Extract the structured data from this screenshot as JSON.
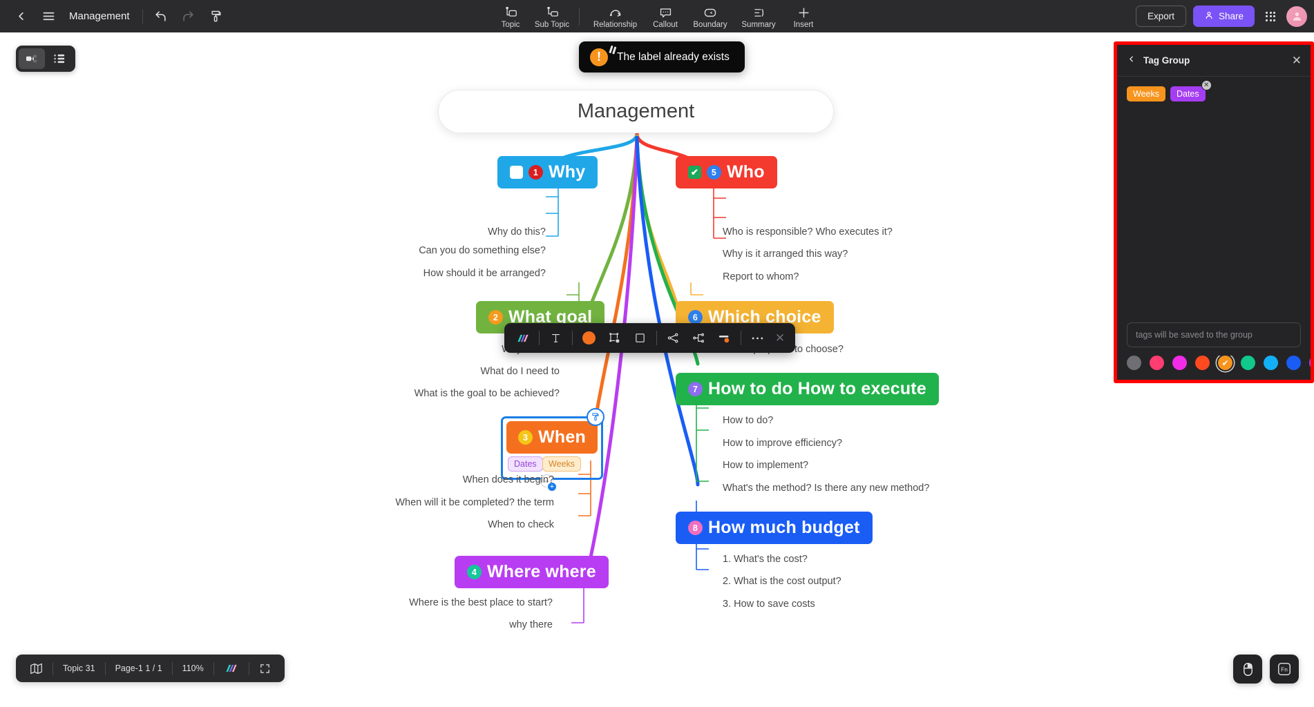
{
  "app": {
    "title": "Management",
    "topbar": {
      "back_icon": "back-chevron-icon",
      "menu_icon": "hamburger-menu-icon",
      "undo_icon": "undo-icon",
      "redo_icon": "redo-icon",
      "format_painter_icon": "format-painter-icon",
      "tools": [
        {
          "label": "Topic",
          "icon": "topic-icon"
        },
        {
          "label": "Sub Topic",
          "icon": "sub-topic-icon"
        },
        {
          "label": "Relationship",
          "icon": "relationship-icon"
        },
        {
          "label": "Callout",
          "icon": "callout-icon"
        },
        {
          "label": "Boundary",
          "icon": "boundary-icon"
        },
        {
          "label": "Summary",
          "icon": "summary-icon"
        },
        {
          "label": "Insert",
          "icon": "insert-plus-icon"
        }
      ],
      "export_label": "Export",
      "share_label": "Share",
      "apps_icon": "apps-grid-icon",
      "avatar_icon": "user-avatar"
    }
  },
  "toast": {
    "message": "The label already exists",
    "icon": "warning-exclamation-icon"
  },
  "view_toggle": {
    "mindmap_icon": "mindmap-view-icon",
    "outline_icon": "outline-view-icon"
  },
  "mindmap": {
    "root": {
      "label": "Management"
    },
    "branches": [
      {
        "id": "why",
        "label": "Why",
        "number": "1",
        "color": "#1fa7e8",
        "badge_color": "#d91f1f",
        "checkbox": "unchecked",
        "children": [
          "Why do this?",
          "Can you do something else?",
          "How should it be arranged?"
        ]
      },
      {
        "id": "what-goal",
        "label": "What goal",
        "number": "2",
        "color": "#72b340",
        "badge_color": "#f59b1e",
        "children": [
          "Why do this?",
          "What do I need to",
          "What is the goal to be achieved?"
        ]
      },
      {
        "id": "when",
        "label": "When",
        "number": "3",
        "color": "#f4701f",
        "badge_color": "#f5c518",
        "selected": true,
        "tags": [
          "Dates",
          "Weeks"
        ],
        "children": [
          "When does it begin?",
          "When will it be completed? the term",
          "When to check"
        ]
      },
      {
        "id": "where-where",
        "label": "Where where",
        "number": "4",
        "color": "#b83df2",
        "badge_color": "#16c79a",
        "children": [
          "Where is the best place to start?",
          "why there"
        ]
      },
      {
        "id": "who",
        "label": "Who",
        "number": "5",
        "color": "#f4392e",
        "badge_color": "#2f80ed",
        "checkbox": "checked",
        "children": [
          "Who is responsible? Who executes it?",
          "Why is it arranged this way?",
          "Report to whom?"
        ]
      },
      {
        "id": "which-choice",
        "label": "Which choice",
        "number": "6",
        "color": "#f5b333",
        "badge_color": "#2f80ed",
        "children": [
          "Which proposal to choose?"
        ]
      },
      {
        "id": "how-to-do",
        "label": "How to do How to execute",
        "number": "7",
        "color": "#22b24c",
        "badge_color": "#8e6df0",
        "children": [
          "How to do?",
          "How to improve efficiency?",
          "How to implement?",
          "What's the method? Is there any new method?"
        ]
      },
      {
        "id": "how-much-budget",
        "label": "How much budget",
        "number": "8",
        "color": "#1a5df5",
        "badge_color": "#f06fc0",
        "children": [
          "1. What's the cost?",
          "2. What is the cost output?",
          "3. How to save costs"
        ]
      }
    ],
    "node_controls": {
      "brush_icon": "brush-style-icon",
      "collapse_label": "−",
      "add_label": "+"
    }
  },
  "format_toolbar": {
    "items": [
      {
        "icon": "ai-sparkle-icon",
        "name": "ai-style-button"
      },
      {
        "icon": "text-format-icon",
        "name": "text-format-button"
      },
      {
        "icon": "fill-color-icon",
        "name": "fill-color-button"
      },
      {
        "icon": "shape-icon",
        "name": "shape-button"
      },
      {
        "icon": "border-icon",
        "name": "border-button"
      },
      {
        "icon": "branch-layout-icon",
        "name": "branch-layout-button"
      },
      {
        "icon": "structure-icon",
        "name": "structure-button"
      },
      {
        "icon": "line-style-icon",
        "name": "line-style-button"
      },
      {
        "icon": "more-dots-icon",
        "name": "more-options-button"
      }
    ],
    "close_icon": "close-icon"
  },
  "statusbar": {
    "map_icon": "map-overview-icon",
    "topic_count": "Topic 31",
    "page": "Page-1  1 / 1",
    "zoom": "110%",
    "ai_icon": "ai-sparkle-icon",
    "fullscreen_icon": "fullscreen-icon"
  },
  "fabs": [
    {
      "icon": "mouse-mode-icon",
      "name": "mouse-mode-button"
    },
    {
      "icon": "fn-shortcuts-icon",
      "name": "fn-shortcuts-button"
    }
  ],
  "tag_panel": {
    "back_icon": "back-chevron-icon",
    "title": "Tag Group",
    "close_icon": "close-icon",
    "chips": [
      {
        "label": "Weeks",
        "color": "#f7941e"
      },
      {
        "label": "Dates",
        "color": "#a53df2",
        "removable": true
      }
    ],
    "remove_icon": "remove-chip-icon",
    "input_placeholder": "tags will be saved to the group",
    "colors": [
      {
        "hex": "#6e6e73",
        "selected": false
      },
      {
        "hex": "#ff3d71",
        "selected": false
      },
      {
        "hex": "#f02ce8",
        "selected": false
      },
      {
        "hex": "#ff4a1f",
        "selected": false
      },
      {
        "hex": "#f7941e",
        "selected": true
      },
      {
        "hex": "#10c98a",
        "selected": false
      },
      {
        "hex": "#13b0f5",
        "selected": false
      },
      {
        "hex": "#1a5df5",
        "selected": false
      },
      {
        "hex": "#a53df2",
        "selected": false
      }
    ],
    "selected_check_icon": "check-icon"
  }
}
